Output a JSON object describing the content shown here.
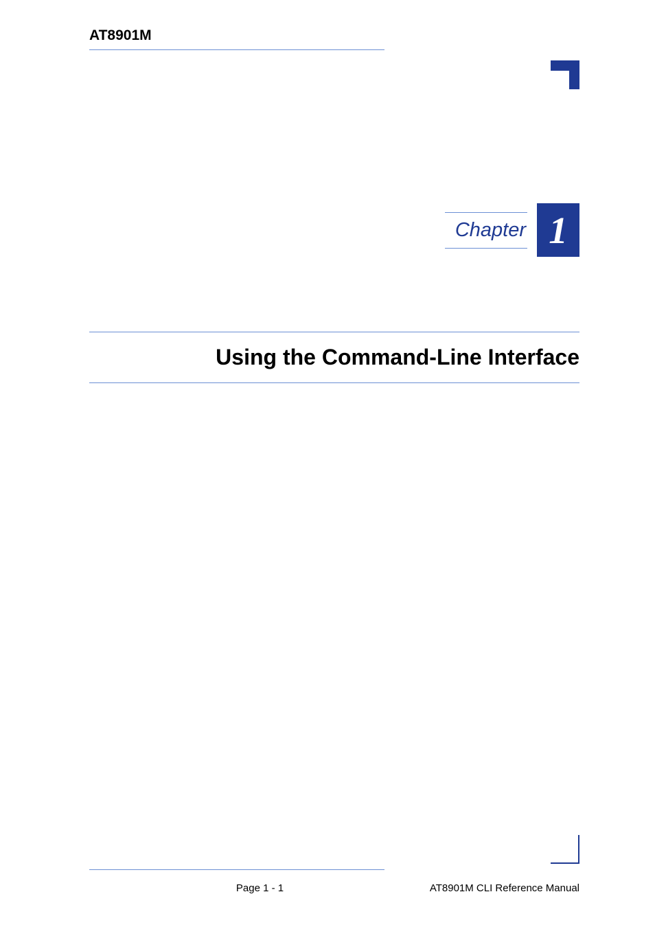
{
  "header": {
    "product": "AT8901M"
  },
  "chapter": {
    "label": "Chapter",
    "number": "1",
    "title": "Using the Command-Line Interface"
  },
  "footer": {
    "page": "Page 1 - 1",
    "manual": "AT8901M CLI Reference Manual"
  }
}
